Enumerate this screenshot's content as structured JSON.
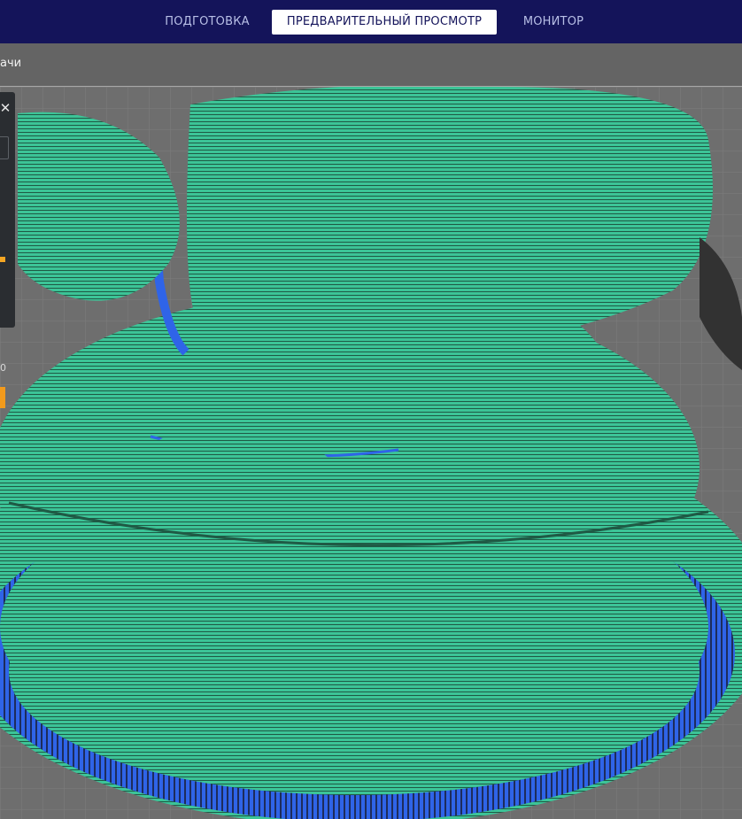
{
  "header": {
    "tabs": [
      {
        "label": "ПОДГОТОВКА",
        "active": false
      },
      {
        "label": "ПРЕДВАРИТЕЛЬНЫЙ ПРОСМОТР",
        "active": true
      },
      {
        "label": "МОНИТОР",
        "active": false
      }
    ]
  },
  "toolbar": {
    "text": "ачи"
  },
  "side_panel": {
    "close_icon": "close-icon",
    "value_text": "0"
  },
  "viewport": {
    "colors": {
      "shell": "#3cc497",
      "line": "#1a4a3a",
      "infill": "#2f64e8",
      "support": "#323232"
    }
  }
}
